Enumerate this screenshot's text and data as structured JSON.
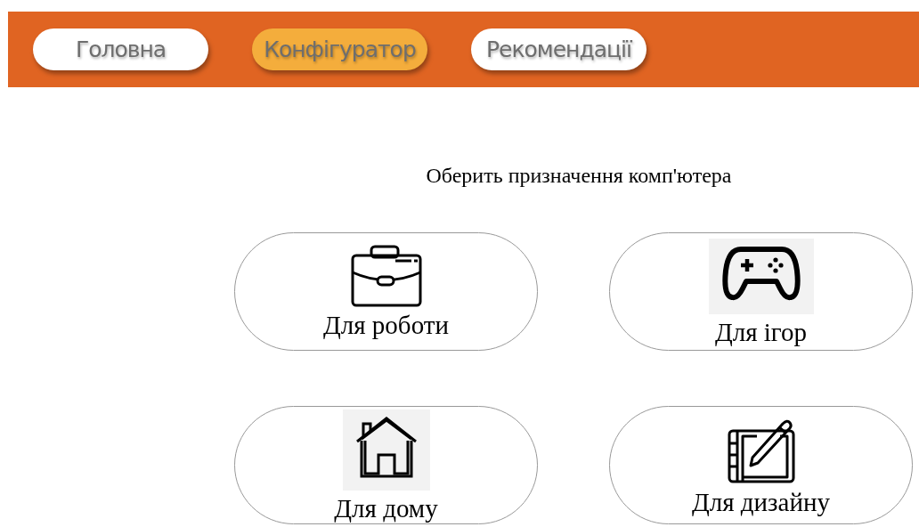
{
  "nav": [
    {
      "label": "Головна",
      "selected": false
    },
    {
      "label": "Конфігуратор",
      "selected": true
    },
    {
      "label": "Рекомендації",
      "selected": false
    }
  ],
  "heading": "Оберить призначення комп'ютера",
  "options": [
    {
      "kind": "work",
      "label": "Для роботи"
    },
    {
      "kind": "games",
      "label": "Для ігор"
    },
    {
      "kind": "home",
      "label": "Для дому"
    },
    {
      "kind": "design",
      "label": "Для дизайну"
    }
  ]
}
